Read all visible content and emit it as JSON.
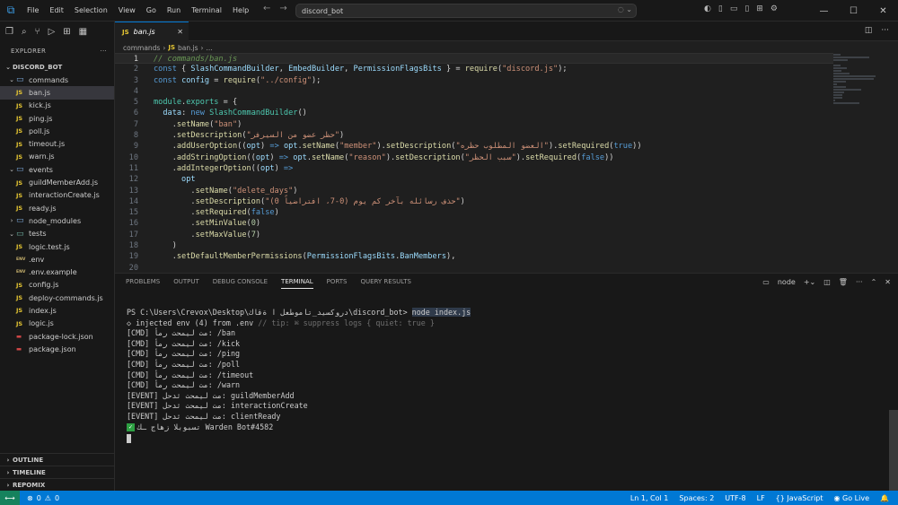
{
  "titlebar": {
    "menu": [
      "File",
      "Edit",
      "Selection",
      "View",
      "Go",
      "Run",
      "Terminal",
      "Help"
    ],
    "search_text": "discord_bot",
    "window_controls": [
      "—",
      "☐",
      "✕"
    ]
  },
  "sidebar": {
    "title": "EXPLORER",
    "root": "DISCORD_BOT",
    "tree": [
      {
        "label": "commands",
        "kind": "folder-open",
        "depth": 1
      },
      {
        "label": "ban.js",
        "kind": "js",
        "depth": 2,
        "selected": true
      },
      {
        "label": "kick.js",
        "kind": "js",
        "depth": 2
      },
      {
        "label": "ping.js",
        "kind": "js",
        "depth": 2
      },
      {
        "label": "poll.js",
        "kind": "js",
        "depth": 2
      },
      {
        "label": "timeout.js",
        "kind": "js",
        "depth": 2
      },
      {
        "label": "warn.js",
        "kind": "js",
        "depth": 2
      },
      {
        "label": "events",
        "kind": "folder-open",
        "depth": 1
      },
      {
        "label": "guildMemberAdd.js",
        "kind": "js",
        "depth": 2
      },
      {
        "label": "interactionCreate.js",
        "kind": "js",
        "depth": 2
      },
      {
        "label": "ready.js",
        "kind": "js",
        "depth": 2
      },
      {
        "label": "node_modules",
        "kind": "folder-closed",
        "depth": 1
      },
      {
        "label": "tests",
        "kind": "testfolder",
        "depth": 1
      },
      {
        "label": "logic.test.js",
        "kind": "js",
        "depth": 2
      },
      {
        "label": ".env",
        "kind": "env",
        "depth": 1
      },
      {
        "label": ".env.example",
        "kind": "env",
        "depth": 1
      },
      {
        "label": "config.js",
        "kind": "js",
        "depth": 1
      },
      {
        "label": "deploy-commands.js",
        "kind": "js",
        "depth": 1
      },
      {
        "label": "index.js",
        "kind": "js",
        "depth": 1
      },
      {
        "label": "logic.js",
        "kind": "js",
        "depth": 1
      },
      {
        "label": "package-lock.json",
        "kind": "json",
        "depth": 1
      },
      {
        "label": "package.json",
        "kind": "json",
        "depth": 1
      }
    ],
    "sections": [
      "OUTLINE",
      "TIMELINE",
      "REPOMIX"
    ]
  },
  "editor": {
    "tab_label": "ban.js",
    "breadcrumb": [
      "commands",
      "ban.js",
      "..."
    ],
    "current_line": 1,
    "lines": [
      [
        [
          "cm",
          "// commands/ban.js"
        ]
      ],
      [
        [
          "kw",
          "const"
        ],
        [
          "pc",
          " { "
        ],
        [
          "vr",
          "SlashCommandBuilder"
        ],
        [
          "pc",
          ", "
        ],
        [
          "vr",
          "EmbedBuilder"
        ],
        [
          "pc",
          ", "
        ],
        [
          "vr",
          "PermissionFlagsBits"
        ],
        [
          "pc",
          " } = "
        ],
        [
          "fn",
          "require"
        ],
        [
          "pc",
          "("
        ],
        [
          "st",
          "\"discord.js\""
        ],
        [
          "pc",
          ");"
        ]
      ],
      [
        [
          "kw",
          "const"
        ],
        [
          "pc",
          " "
        ],
        [
          "vr",
          "config"
        ],
        [
          "pc",
          " = "
        ],
        [
          "fn",
          "require"
        ],
        [
          "pc",
          "("
        ],
        [
          "st",
          "\"../config\""
        ],
        [
          "pc",
          ");"
        ]
      ],
      [
        [
          "pc",
          ""
        ]
      ],
      [
        [
          "tp",
          "module"
        ],
        [
          "pc",
          "."
        ],
        [
          "tp",
          "exports"
        ],
        [
          "pc",
          " = {"
        ]
      ],
      [
        [
          "pc",
          "  "
        ],
        [
          "vr",
          "data"
        ],
        [
          "pc",
          ": "
        ],
        [
          "kw",
          "new"
        ],
        [
          "pc",
          " "
        ],
        [
          "tp",
          "SlashCommandBuilder"
        ],
        [
          "pc",
          "()"
        ]
      ],
      [
        [
          "pc",
          "    ."
        ],
        [
          "fn",
          "setName"
        ],
        [
          "pc",
          "("
        ],
        [
          "st",
          "\"ban\""
        ],
        [
          "pc",
          ")"
        ]
      ],
      [
        [
          "pc",
          "    ."
        ],
        [
          "fn",
          "setDescription"
        ],
        [
          "pc",
          "("
        ],
        [
          "st",
          "\"حظر عضو من السيرفر\""
        ],
        [
          "pc",
          ")"
        ]
      ],
      [
        [
          "pc",
          "    ."
        ],
        [
          "fn",
          "addUserOption"
        ],
        [
          "pc",
          "(("
        ],
        [
          "vr",
          "opt"
        ],
        [
          "pc",
          ") "
        ],
        [
          "kw",
          "=>"
        ],
        [
          "pc",
          " "
        ],
        [
          "vr",
          "opt"
        ],
        [
          "pc",
          "."
        ],
        [
          "fn",
          "setName"
        ],
        [
          "pc",
          "("
        ],
        [
          "st",
          "\"member\""
        ],
        [
          "pc",
          ")."
        ],
        [
          "fn",
          "setDescription"
        ],
        [
          "pc",
          "("
        ],
        [
          "st",
          "\"العضو المطلوب حظره\""
        ],
        [
          "pc",
          ")."
        ],
        [
          "fn",
          "setRequired"
        ],
        [
          "pc",
          "("
        ],
        [
          "kw",
          "true"
        ],
        [
          "pc",
          "))"
        ]
      ],
      [
        [
          "pc",
          "    ."
        ],
        [
          "fn",
          "addStringOption"
        ],
        [
          "pc",
          "(("
        ],
        [
          "vr",
          "opt"
        ],
        [
          "pc",
          ") "
        ],
        [
          "kw",
          "=>"
        ],
        [
          "pc",
          " "
        ],
        [
          "vr",
          "opt"
        ],
        [
          "pc",
          "."
        ],
        [
          "fn",
          "setName"
        ],
        [
          "pc",
          "("
        ],
        [
          "st",
          "\"reason\""
        ],
        [
          "pc",
          ")."
        ],
        [
          "fn",
          "setDescription"
        ],
        [
          "pc",
          "("
        ],
        [
          "st",
          "\"سبب الحظر\""
        ],
        [
          "pc",
          ")."
        ],
        [
          "fn",
          "setRequired"
        ],
        [
          "pc",
          "("
        ],
        [
          "kw",
          "false"
        ],
        [
          "pc",
          "))"
        ]
      ],
      [
        [
          "pc",
          "    ."
        ],
        [
          "fn",
          "addIntegerOption"
        ],
        [
          "pc",
          "(("
        ],
        [
          "vr",
          "opt"
        ],
        [
          "pc",
          ") "
        ],
        [
          "kw",
          "=>"
        ]
      ],
      [
        [
          "pc",
          "      "
        ],
        [
          "vr",
          "opt"
        ]
      ],
      [
        [
          "pc",
          "        ."
        ],
        [
          "fn",
          "setName"
        ],
        [
          "pc",
          "("
        ],
        [
          "st",
          "\"delete_days\""
        ],
        [
          "pc",
          ")"
        ]
      ],
      [
        [
          "pc",
          "        ."
        ],
        [
          "fn",
          "setDescription"
        ],
        [
          "pc",
          "("
        ],
        [
          "st",
          "\"حذف رسائله بآخر كم يوم (0-7، افتراضياً 0)\""
        ],
        [
          "pc",
          ")"
        ]
      ],
      [
        [
          "pc",
          "        ."
        ],
        [
          "fn",
          "setRequired"
        ],
        [
          "pc",
          "("
        ],
        [
          "kw",
          "false"
        ],
        [
          "pc",
          ")"
        ]
      ],
      [
        [
          "pc",
          "        ."
        ],
        [
          "fn",
          "setMinValue"
        ],
        [
          "pc",
          "("
        ],
        [
          "nm",
          "0"
        ],
        [
          "pc",
          ")"
        ]
      ],
      [
        [
          "pc",
          "        ."
        ],
        [
          "fn",
          "setMaxValue"
        ],
        [
          "pc",
          "("
        ],
        [
          "nm",
          "7"
        ],
        [
          "pc",
          ")"
        ]
      ],
      [
        [
          "pc",
          "    )"
        ]
      ],
      [
        [
          "pc",
          "    ."
        ],
        [
          "fn",
          "setDefaultMemberPermissions"
        ],
        [
          "pc",
          "("
        ],
        [
          "vr",
          "PermissionFlagsBits"
        ],
        [
          "pc",
          "."
        ],
        [
          "vr",
          "BanMembers"
        ],
        [
          "pc",
          "),"
        ]
      ],
      [
        [
          "pc",
          ""
        ]
      ]
    ]
  },
  "panel": {
    "tabs": [
      "PROBLEMS",
      "OUTPUT",
      "DEBUG CONSOLE",
      "TERMINAL",
      "PORTS",
      "QUERY RESULTS"
    ],
    "active_tab": "TERMINAL",
    "shell_label": "node",
    "prompt": "PS C:\\Users\\Crevox\\Desktop\\دروكسيد_تاموطعل ا ةقاك\\discord_bot> ",
    "command": "node index.js",
    "env_line": "◇ injected env (4) from .env",
    "env_tip": " // tip: ⌘ suppress logs { quiet: true }",
    "log_lines": [
      "[CMD] مت ليمحت رمأ: /ban",
      "[CMD] مت ليمحت رمأ: /kick",
      "[CMD] مت ليمحت رمأ: /ping",
      "[CMD] مت ليمحت رمأ: /poll",
      "[CMD] مت ليمحت رمأ: /timeout",
      "[CMD] مت ليمحت رمأ: /warn",
      "[EVENT] مت ليمحت ثدحل: guildMemberAdd",
      "[EVENT] مت ليمحت ثدحل: interactionCreate",
      "[EVENT] مت ليمحت ثدحل: clientReady"
    ],
    "ready_line": "تسبوبلا زهاج ـك Warden Bot#4582"
  },
  "statusbar": {
    "errors": "0",
    "warnings": "0",
    "position": "Ln 1, Col 1",
    "spaces": "Spaces: 2",
    "encoding": "UTF-8",
    "eol": "LF",
    "language": "JavaScript",
    "golive": "Go Live"
  },
  "colors": {
    "accent": "#0078d4",
    "editor_bg": "#1f1f1f",
    "sidebar_bg": "#181818",
    "remote": "#16825d"
  }
}
